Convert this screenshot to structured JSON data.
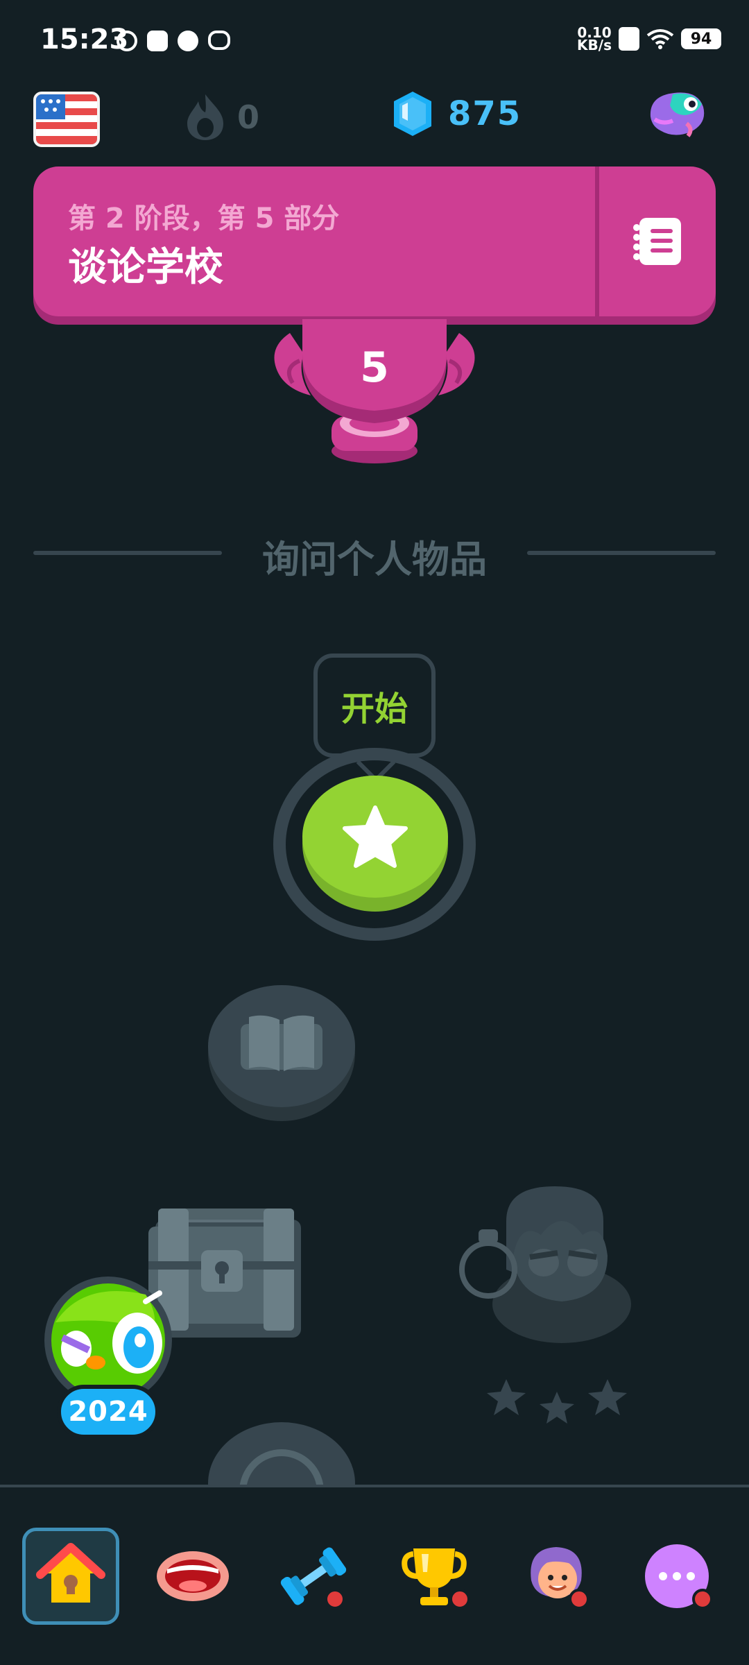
{
  "status_bar": {
    "time": "15:23",
    "net_speed_value": "0.10",
    "net_speed_unit": "KB/s",
    "battery": "94"
  },
  "top_stats": {
    "course_flag": "us-flag",
    "streak_count": "0",
    "gems_count": "875",
    "profile_icon": "owl-icon"
  },
  "unit_banner": {
    "subtitle": "第 2 阶段，第 5 部分",
    "title": "谈论学校",
    "guide_icon": "notebook-icon",
    "color": "#ce3e93"
  },
  "trophy": {
    "level": "5"
  },
  "section": {
    "title": "询问个人物品"
  },
  "path": {
    "start_label": "开始",
    "active_color": "#93d333"
  },
  "badge": {
    "year": "2024"
  },
  "bottom_nav": {
    "items": [
      {
        "name": "home",
        "icon": "home-icon",
        "active": true,
        "notification": false
      },
      {
        "name": "speak",
        "icon": "mouth-icon",
        "active": false,
        "notification": false
      },
      {
        "name": "practice",
        "icon": "dumbbell-icon",
        "active": false,
        "notification": true
      },
      {
        "name": "leaderboard",
        "icon": "trophy-icon",
        "active": false,
        "notification": true
      },
      {
        "name": "profile",
        "icon": "avatar-icon",
        "active": false,
        "notification": true
      },
      {
        "name": "more",
        "icon": "more-icon",
        "active": false,
        "notification": true
      }
    ]
  }
}
